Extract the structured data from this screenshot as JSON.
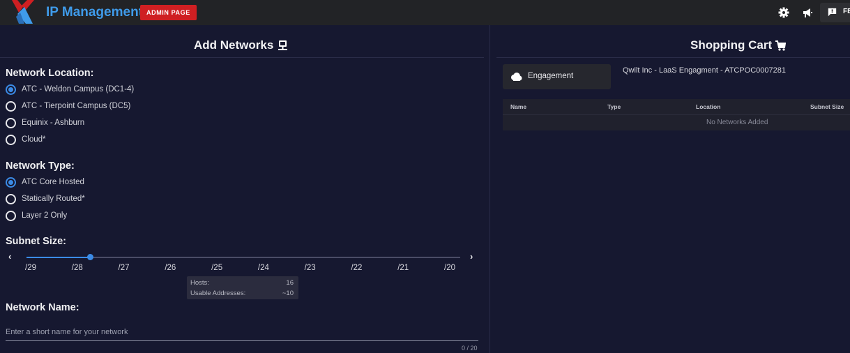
{
  "header": {
    "app_title": "IP Management",
    "admin_badge": "ADMIN PAGE",
    "icons": [
      "gear-icon",
      "megaphone-icon",
      "feedback-icon"
    ],
    "feedback_label": "FE",
    "brand_color": "#3f9bea",
    "badge_color": "#cf1f22"
  },
  "add_panel": {
    "title": "Add Networks",
    "title_icon": "network-icon",
    "network_location": {
      "label": "Network Location:",
      "options": [
        {
          "label": "ATC - Weldon Campus (DC1-4)",
          "checked": true
        },
        {
          "label": "ATC - Tierpoint Campus (DC5)",
          "checked": false
        },
        {
          "label": "Equinix - Ashburn",
          "checked": false
        },
        {
          "label": "Cloud*",
          "checked": false
        }
      ]
    },
    "network_type": {
      "label": "Network Type:",
      "options": [
        {
          "label": "ATC Core Hosted",
          "checked": true
        },
        {
          "label": "Statically Routed*",
          "checked": false
        },
        {
          "label": "Layer 2 Only",
          "checked": false
        }
      ]
    },
    "subnet_size": {
      "label": "Subnet Size:",
      "ticks": [
        "/29",
        "/28",
        "/27",
        "/26",
        "/25",
        "/24",
        "/23",
        "/22",
        "/21",
        "/20"
      ],
      "selected": "/28",
      "tooltip": {
        "hosts_label": "Hosts:",
        "hosts_value": "16",
        "usable_label": "Usable Addresses:",
        "usable_value": "~10"
      }
    },
    "network_name": {
      "label": "Network Name:",
      "placeholder": "Enter a short name for your network",
      "value": "",
      "counter": "0 / 20"
    },
    "accent_color": "#3b8be6"
  },
  "cart_panel": {
    "title": "Shopping Cart",
    "title_icon": "cart-icon",
    "engagement_button": "Engagement",
    "engagement_icon": "cloud-icon",
    "customer_text": "Qwilt Inc - LaaS Engagment - ATCPOC0007281",
    "table": {
      "columns": [
        "Name",
        "Type",
        "Location",
        "Subnet Size"
      ],
      "rows": [],
      "empty_message": "No Networks Added"
    }
  }
}
